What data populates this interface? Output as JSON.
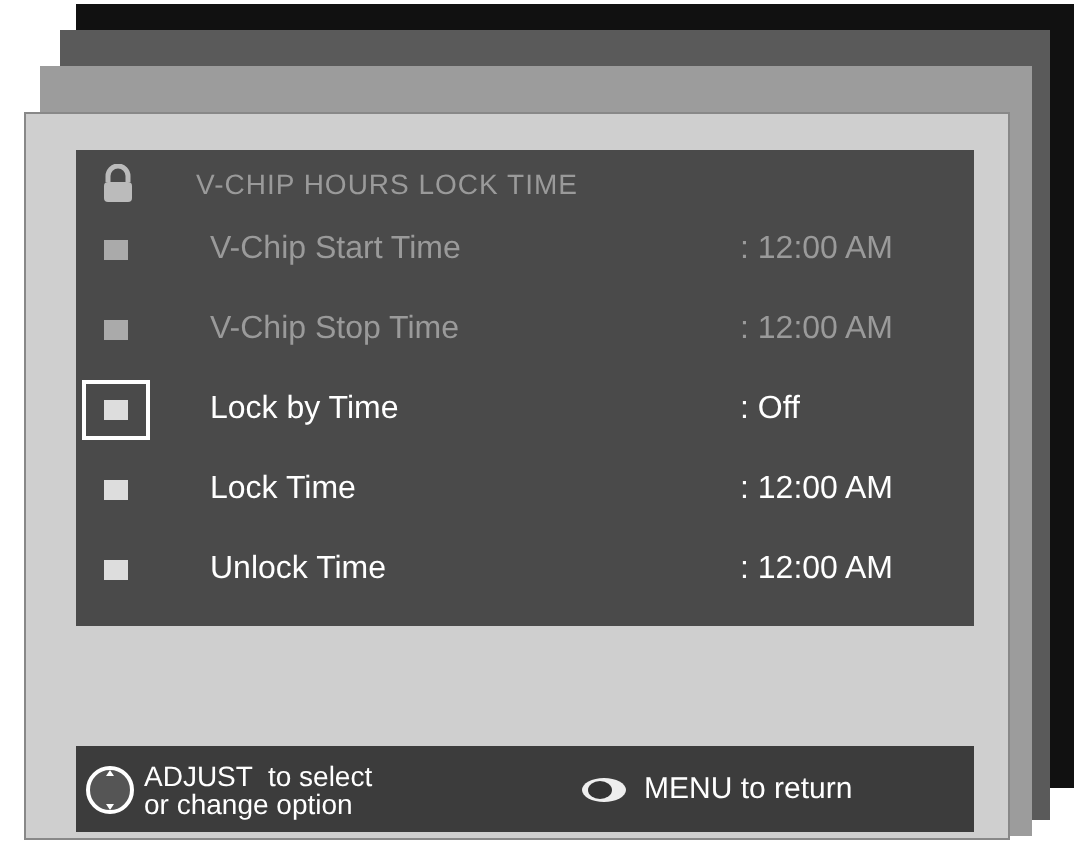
{
  "menu": {
    "title": "V-CHIP HOURS LOCK TIME",
    "title_disabled": true,
    "items": [
      {
        "label": "V-Chip Start Time",
        "value": ": 12:00 AM",
        "disabled": true,
        "selected": false
      },
      {
        "label": "V-Chip Stop Time",
        "value": ": 12:00 AM",
        "disabled": true,
        "selected": false
      },
      {
        "label": "Lock by Time",
        "value": ": Off",
        "disabled": false,
        "selected": true
      },
      {
        "label": "Lock Time",
        "value": ": 12:00 AM",
        "disabled": false,
        "selected": false
      },
      {
        "label": "Unlock Time",
        "value": ": 12:00 AM",
        "disabled": false,
        "selected": false
      }
    ]
  },
  "footer": {
    "adjust_hint": "ADJUST  to select\nor change option",
    "menu_hint": "MENU to return"
  }
}
